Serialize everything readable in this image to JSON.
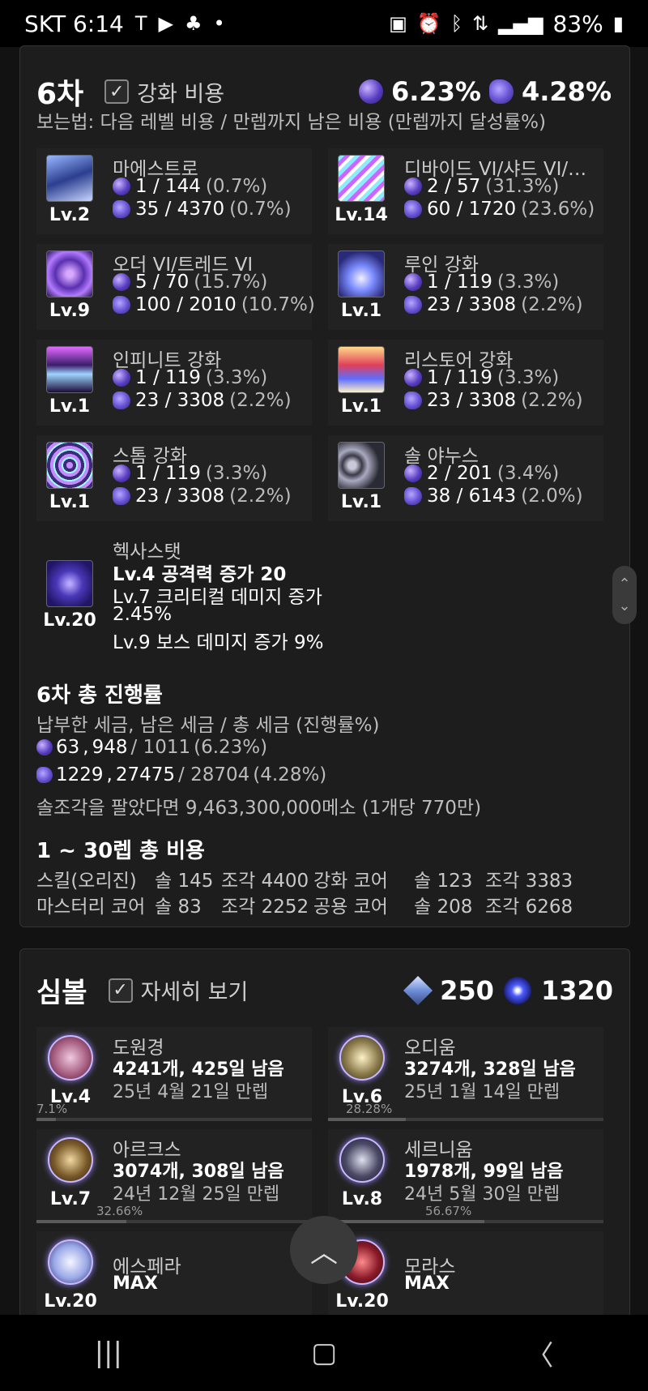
{
  "status": {
    "carrier_time": "SKT 6:14",
    "battery": "83%"
  },
  "sixth": {
    "title": "6차",
    "checkbox_label": "강화 비용",
    "pct_a": "6.23%",
    "pct_b": "4.28%",
    "howto": "보는법: 다음 레벨 비용 / 만렙까지 남은 비용 (만렙까지 달성률%)",
    "skills": [
      {
        "name": "마에스트로",
        "lv": "Lv.2",
        "a": "1 / 144",
        "ap": "(0.7%)",
        "b": "35 / 4370",
        "bp": "(0.7%)"
      },
      {
        "name": "디바이드 VI/샤드 VI/원…",
        "lv": "Lv.14",
        "a": "2 / 57",
        "ap": "(31.3%)",
        "b": "60 / 1720",
        "bp": "(23.6%)"
      },
      {
        "name": "오더 VI/트레드 VI",
        "lv": "Lv.9",
        "a": "5 / 70",
        "ap": "(15.7%)",
        "b": "100 / 2010",
        "bp": "(10.7%)"
      },
      {
        "name": "루인 강화",
        "lv": "Lv.1",
        "a": "1 / 119",
        "ap": "(3.3%)",
        "b": "23 / 3308",
        "bp": "(2.2%)"
      },
      {
        "name": "인피니트 강화",
        "lv": "Lv.1",
        "a": "1 / 119",
        "ap": "(3.3%)",
        "b": "23 / 3308",
        "bp": "(2.2%)"
      },
      {
        "name": "리스토어 강화",
        "lv": "Lv.1",
        "a": "1 / 119",
        "ap": "(3.3%)",
        "b": "23 / 3308",
        "bp": "(2.2%)"
      },
      {
        "name": "스톰 강화",
        "lv": "Lv.1",
        "a": "1 / 119",
        "ap": "(3.3%)",
        "b": "23 / 3308",
        "bp": "(2.2%)"
      },
      {
        "name": "솔 야누스",
        "lv": "Lv.1",
        "a": "2 / 201",
        "ap": "(3.4%)",
        "b": "38 / 6143",
        "bp": "(2.0%)"
      }
    ],
    "hexa": {
      "name": "헥사스탯",
      "lv": "Lv.20",
      "l1": "Lv.4 공격력 증가 20",
      "l2": "Lv.7 크리티컬 데미지 증가",
      "l3": "2.45%",
      "l4": "Lv.9 보스 데미지 증가 9%"
    },
    "total": {
      "title": "6차 총 진행률",
      "desc": "납부한 세금, 남은 세금 / 총 세금 (진행률%)",
      "a_paid": "63",
      "a_left": "948",
      "a_total": "/ 1011",
      "a_pct": "(6.23%)",
      "b_paid": "1229",
      "b_left": "27475",
      "b_total": "/ 28704",
      "b_pct": "(4.28%)",
      "sell": "솔조각을 팔았다면 9,463,300,000메소 (1개당 770만)"
    },
    "cost": {
      "title": "1 ~ 30렙 총 비용",
      "r1": [
        "스킬(오리진)",
        "솔 145",
        "조각 4400",
        "강화 코어",
        "솔 123",
        "조각 3383"
      ],
      "r2": [
        "마스터리 코어",
        "솔 83",
        "조각 2252",
        "공용 코어",
        "솔 208",
        "조각 6268"
      ]
    }
  },
  "symbol": {
    "title": "심볼",
    "checkbox_label": "자세히 보기",
    "arcane": "250",
    "authentic": "1320",
    "items": [
      {
        "name": "도원경",
        "lv": "Lv.4",
        "d1": "4241개, 425일 남음",
        "d2": "25년 4월 21일 만렙",
        "pct": "7.1%",
        "progress": 0.071
      },
      {
        "name": "오디움",
        "lv": "Lv.6",
        "d1": "3274개, 328일 남음",
        "d2": "25년 1월 14일 만렙",
        "pct": "28.28%",
        "progress": 0.2828
      },
      {
        "name": "아르크스",
        "lv": "Lv.7",
        "d1": "3074개, 308일 남음",
        "d2": "24년 12월 25일 만렙",
        "pct": "32.66%",
        "progress": 0.3266
      },
      {
        "name": "세르니움",
        "lv": "Lv.8",
        "d1": "1978개, 99일 남음",
        "d2": "24년 5월 30일 만렙",
        "pct": "56.67%",
        "progress": 0.5667
      },
      {
        "name": "에스페라",
        "lv": "Lv.20",
        "d1": "MAX",
        "d2": ""
      },
      {
        "name": "모라스",
        "lv": "Lv.20",
        "d1": "MAX",
        "d2": ""
      }
    ]
  }
}
